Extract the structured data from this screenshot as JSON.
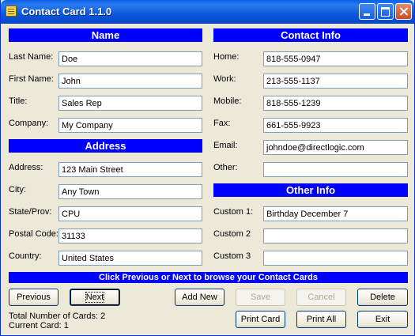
{
  "window": {
    "title": "Contact Card 1.1.0"
  },
  "sections": {
    "name": "Name",
    "contact_info": "Contact Info",
    "address": "Address",
    "other_info": "Other Info"
  },
  "name": {
    "last_name": {
      "label": "Last Name:",
      "value": "Doe"
    },
    "first_name": {
      "label": "First Name:",
      "value": "John"
    },
    "title": {
      "label": "Title:",
      "value": "Sales Rep"
    },
    "company": {
      "label": "Company:",
      "value": "My Company"
    }
  },
  "contact": {
    "home": {
      "label": "Home:",
      "value": "818-555-0947"
    },
    "work": {
      "label": "Work:",
      "value": "213-555-1137"
    },
    "mobile": {
      "label": "Mobile:",
      "value": "818-555-1239"
    },
    "fax": {
      "label": "Fax:",
      "value": "661-555-9923"
    },
    "email": {
      "label": "Email:",
      "value": "johndoe@directlogic.com"
    },
    "other": {
      "label": "Other:",
      "value": ""
    }
  },
  "address": {
    "address": {
      "label": "Address:",
      "value": "123 Main Street"
    },
    "city": {
      "label": "City:",
      "value": "Any Town"
    },
    "state": {
      "label": "State/Prov:",
      "value": "CPU"
    },
    "postal": {
      "label": "Postal Code:",
      "value": "31133"
    },
    "country": {
      "label": "Country:",
      "value": "United States"
    }
  },
  "other": {
    "custom1": {
      "label": "Custom 1:",
      "value": "Birthday December 7"
    },
    "custom2": {
      "label": "Custom 2",
      "value": ""
    },
    "custom3": {
      "label": "Custom 3",
      "value": ""
    }
  },
  "banner": "Click Previous or Next to browse your Contact Cards",
  "buttons": {
    "previous": "Previous",
    "next": "Next",
    "add_new": "Add New",
    "save": "Save",
    "cancel": "Cancel",
    "delete": "Delete",
    "print_card": "Print Card",
    "print_all": "Print All",
    "exit": "Exit"
  },
  "status": {
    "total": "Total Number of Cards: 2",
    "current": "Current Card: 1"
  }
}
